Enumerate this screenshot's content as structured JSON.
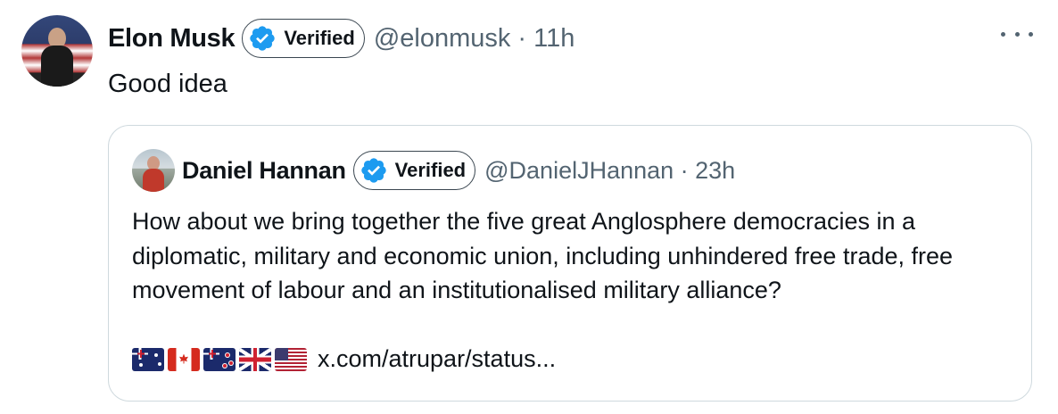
{
  "tweet": {
    "author_name": "Elon Musk",
    "verified_label": "Verified",
    "handle_time": "@elonmusk · 11h",
    "text": "Good idea"
  },
  "quote": {
    "author_name": "Daniel Hannan",
    "verified_label": "Verified",
    "handle_time": "@DanielJHannan · 23h",
    "text": "How about we bring together the five great Anglosphere democracies in a diplomatic, military and economic union, including unhindered free trade, free movement of labour and an institutionalised military alliance?",
    "link_text": "x.com/atrupar/status...",
    "flags": [
      "flag-australia-icon",
      "flag-canada-icon",
      "flag-new-zealand-icon",
      "flag-united-kingdom-icon",
      "flag-united-states-icon"
    ]
  },
  "icons": {
    "verified": "verified-badge-icon",
    "more": "more-options-icon"
  },
  "colors": {
    "verified_blue": "#1d9bf0",
    "secondary_text": "#536471",
    "border": "#cfd9de"
  }
}
